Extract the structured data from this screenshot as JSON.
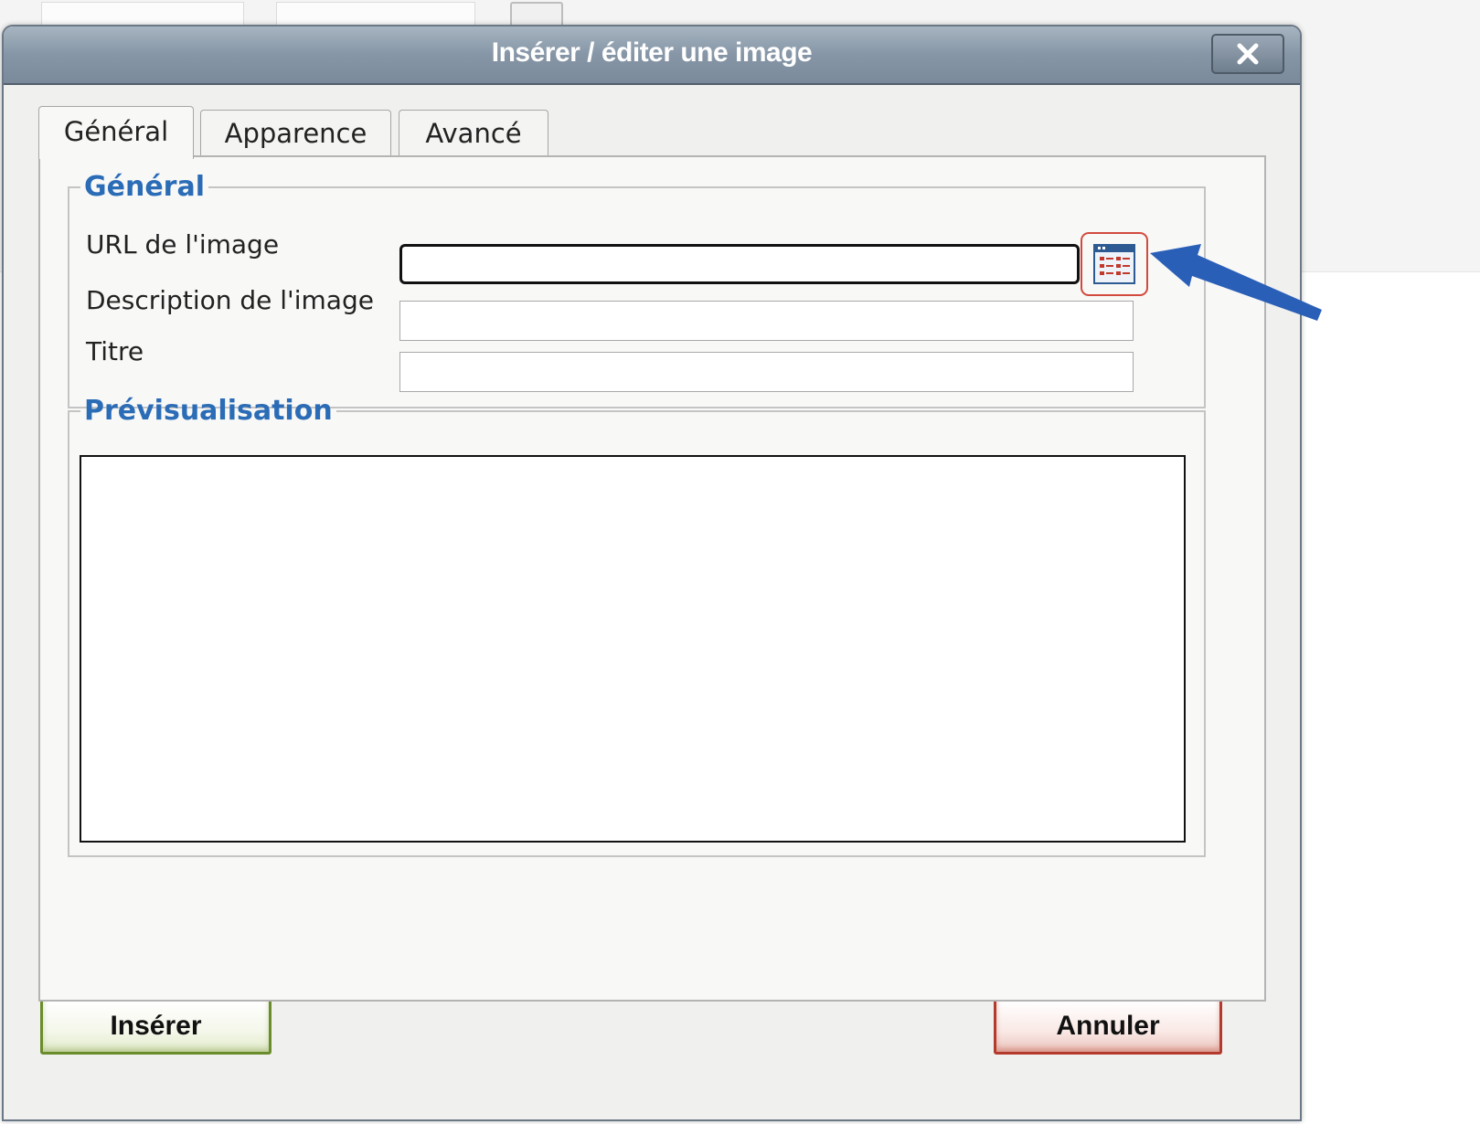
{
  "dialog": {
    "title": "Insérer / éditer une image"
  },
  "tabs": [
    {
      "label": "Général",
      "active": true
    },
    {
      "label": "Apparence",
      "active": false
    },
    {
      "label": "Avancé",
      "active": false
    }
  ],
  "general": {
    "legend": "Général",
    "fields": [
      {
        "label": "URL de l'image",
        "value": ""
      },
      {
        "label": "Description de l'image",
        "value": ""
      },
      {
        "label": "Titre",
        "value": ""
      }
    ],
    "browse_icon": "file-browser-icon"
  },
  "preview": {
    "legend": "Prévisualisation"
  },
  "buttons": {
    "insert": "Insérer",
    "cancel": "Annuler"
  },
  "colors": {
    "legend": "#2b6cb7",
    "highlight": "#d24a3e",
    "arrow": "#2a5fb8",
    "insert_border": "#6a8c2a",
    "cancel_border": "#b33a2c"
  },
  "icons": {
    "close": "close-icon",
    "browse": "file-browser-icon",
    "annotation": "arrow-annotation"
  }
}
